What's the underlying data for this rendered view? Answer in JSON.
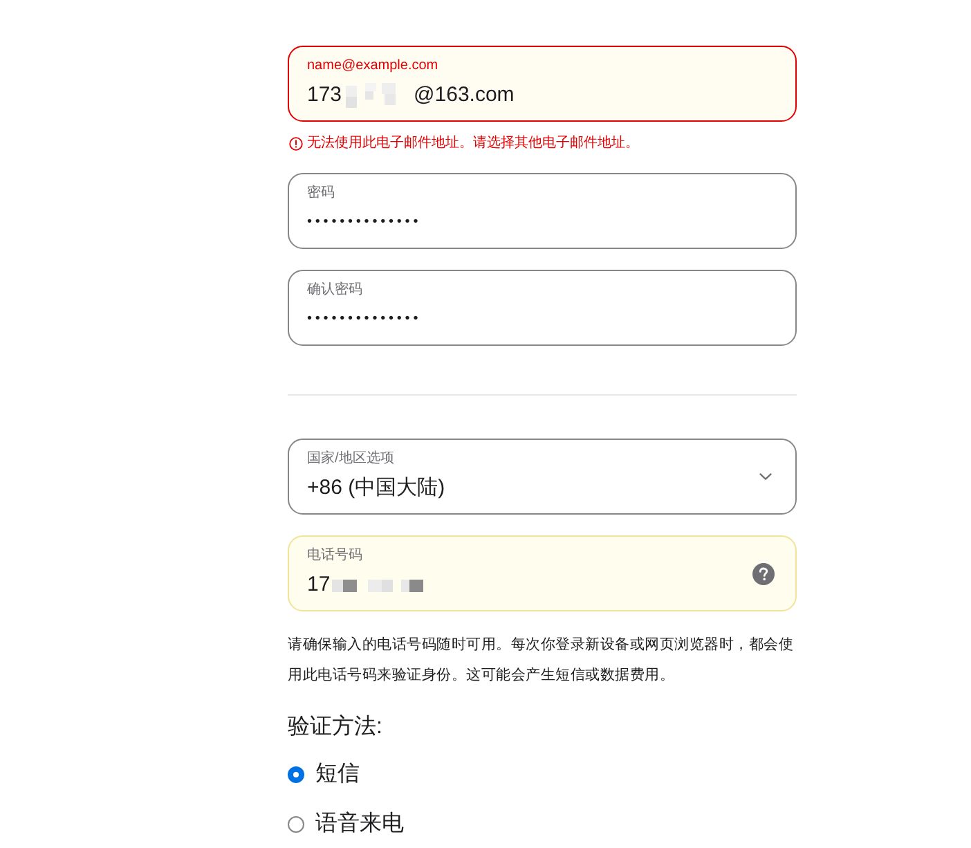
{
  "email_field": {
    "label": "name@example.com",
    "invalid": true,
    "autofilled": true,
    "value": [
      {
        "kind": "text",
        "text": "173"
      },
      {
        "kind": "redacted"
      },
      {
        "kind": "text",
        "text": "@163.com"
      }
    ],
    "error_message": "无法使用此电子邮件地址。请选择其他电子邮件地址。"
  },
  "password_fields": [
    {
      "label": "密码",
      "invalid": false,
      "autofilled": false,
      "value": "••••••••••••••"
    },
    {
      "label": "确认密码",
      "invalid": false,
      "autofilled": false,
      "value": "••••••••••••••"
    }
  ],
  "country_select": {
    "label": "国家/地区选项",
    "invalid": false,
    "autofilled": false,
    "value": "+86 (中国大陆)"
  },
  "phone_field": {
    "label": "电话号码",
    "invalid": false,
    "autofilled": true,
    "value": [
      {
        "kind": "text",
        "text": "17"
      },
      {
        "kind": "redacted"
      }
    ]
  },
  "phone_note": "请确保输入的电话号码随时可用。每次你登录新设备或网页浏览器时，都会使用此电话号码来验证身份。这可能会产生短信或数据费用。",
  "verification_method": {
    "title": "验证方法:",
    "options": [
      {
        "label": "短信",
        "selected": true
      },
      {
        "label": "语音来电",
        "selected": false
      }
    ]
  }
}
